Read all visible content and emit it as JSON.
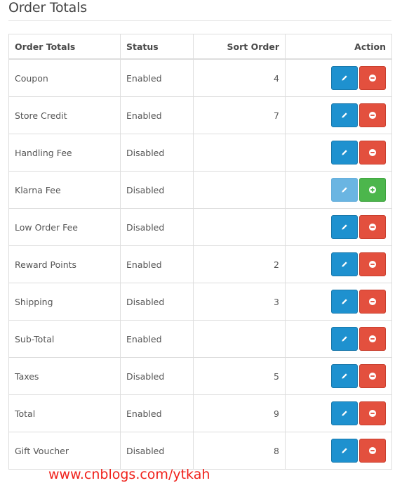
{
  "page": {
    "title": "Order Totals"
  },
  "table": {
    "headers": {
      "name": "Order Totals",
      "status": "Status",
      "sort_order": "Sort Order",
      "action": "Action"
    },
    "rows": [
      {
        "name": "Coupon",
        "status": "Enabled",
        "sort_order": "4",
        "installed": true
      },
      {
        "name": "Store Credit",
        "status": "Enabled",
        "sort_order": "7",
        "installed": true
      },
      {
        "name": "Handling Fee",
        "status": "Disabled",
        "sort_order": "",
        "installed": true
      },
      {
        "name": "Klarna Fee",
        "status": "Disabled",
        "sort_order": "",
        "installed": false
      },
      {
        "name": "Low Order Fee",
        "status": "Disabled",
        "sort_order": "",
        "installed": true
      },
      {
        "name": "Reward Points",
        "status": "Enabled",
        "sort_order": "2",
        "installed": true
      },
      {
        "name": "Shipping",
        "status": "Disabled",
        "sort_order": "3",
        "installed": true
      },
      {
        "name": "Sub-Total",
        "status": "Enabled",
        "sort_order": "",
        "installed": true
      },
      {
        "name": "Taxes",
        "status": "Disabled",
        "sort_order": "5",
        "installed": true
      },
      {
        "name": "Total",
        "status": "Enabled",
        "sort_order": "9",
        "installed": true
      },
      {
        "name": "Gift Voucher",
        "status": "Disabled",
        "sort_order": "8",
        "installed": true
      }
    ]
  },
  "icons": {
    "edit": "pencil-icon",
    "uninstall": "minus-circle-icon",
    "install": "plus-circle-icon"
  },
  "colors": {
    "edit": "#1e91cf",
    "edit_disabled": "#6ab5e2",
    "uninstall": "#e3503e",
    "install": "#4cb64c",
    "watermark": "#f0211b"
  },
  "watermark": "www.cnblogs.com/ytkah"
}
